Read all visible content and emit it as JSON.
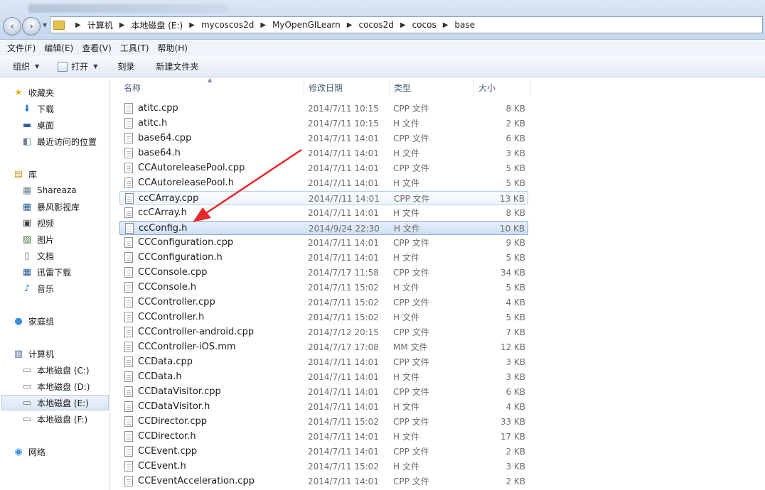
{
  "address": {
    "crumbs": [
      "计算机",
      "本地磁盘 (E:)",
      "mycoscos2d",
      "MyOpenGlLearn",
      "cocos2d",
      "cocos",
      "base"
    ]
  },
  "menu": [
    "文件(F)",
    "编辑(E)",
    "查看(V)",
    "工具(T)",
    "帮助(H)"
  ],
  "toolbar": {
    "organize": "组织",
    "open": "打开",
    "burn": "刻录",
    "new_folder": "新建文件夹"
  },
  "sidebar": {
    "favorites": {
      "label": "收藏夹",
      "items": [
        "下载",
        "桌面",
        "最近访问的位置"
      ]
    },
    "libraries": {
      "label": "库",
      "items": [
        "Shareaza",
        "暴风影视库",
        "视频",
        "图片",
        "文档",
        "迅雷下载",
        "音乐"
      ]
    },
    "homegroup": "家庭组",
    "computer": {
      "label": "计算机",
      "items": [
        "本地磁盘 (C:)",
        "本地磁盘 (D:)",
        "本地磁盘 (E:)",
        "本地磁盘 (F:)"
      ]
    },
    "network": "网络"
  },
  "columns": {
    "name": "名称",
    "date": "修改日期",
    "type": "类型",
    "size": "大小"
  },
  "files": [
    {
      "name": "atitc.cpp",
      "date": "2014/7/11 10:15",
      "type": "CPP 文件",
      "size": "8 KB"
    },
    {
      "name": "atitc.h",
      "date": "2014/7/11 10:15",
      "type": "H 文件",
      "size": "2 KB"
    },
    {
      "name": "base64.cpp",
      "date": "2014/7/11 14:01",
      "type": "CPP 文件",
      "size": "6 KB"
    },
    {
      "name": "base64.h",
      "date": "2014/7/11 14:01",
      "type": "H 文件",
      "size": "3 KB"
    },
    {
      "name": "CCAutoreleasePool.cpp",
      "date": "2014/7/11 14:01",
      "type": "CPP 文件",
      "size": "5 KB"
    },
    {
      "name": "CCAutoreleasePool.h",
      "date": "2014/7/11 14:01",
      "type": "H 文件",
      "size": "5 KB"
    },
    {
      "name": "ccCArray.cpp",
      "date": "2014/7/11 14:01",
      "type": "CPP 文件",
      "size": "13 KB"
    },
    {
      "name": "ccCArray.h",
      "date": "2014/7/11 14:01",
      "type": "H 文件",
      "size": "8 KB"
    },
    {
      "name": "ccConfig.h",
      "date": "2014/9/24 22:30",
      "type": "H 文件",
      "size": "10 KB"
    },
    {
      "name": "CCConfiguration.cpp",
      "date": "2014/7/11 14:01",
      "type": "CPP 文件",
      "size": "9 KB"
    },
    {
      "name": "CCConfiguration.h",
      "date": "2014/7/11 14:01",
      "type": "H 文件",
      "size": "5 KB"
    },
    {
      "name": "CCConsole.cpp",
      "date": "2014/7/17 11:58",
      "type": "CPP 文件",
      "size": "34 KB"
    },
    {
      "name": "CCConsole.h",
      "date": "2014/7/11 15:02",
      "type": "H 文件",
      "size": "5 KB"
    },
    {
      "name": "CCController.cpp",
      "date": "2014/7/11 15:02",
      "type": "CPP 文件",
      "size": "4 KB"
    },
    {
      "name": "CCController.h",
      "date": "2014/7/11 15:02",
      "type": "H 文件",
      "size": "5 KB"
    },
    {
      "name": "CCController-android.cpp",
      "date": "2014/7/12 20:15",
      "type": "CPP 文件",
      "size": "7 KB"
    },
    {
      "name": "CCController-iOS.mm",
      "date": "2014/7/17 17:08",
      "type": "MM 文件",
      "size": "12 KB"
    },
    {
      "name": "CCData.cpp",
      "date": "2014/7/11 14:01",
      "type": "CPP 文件",
      "size": "3 KB"
    },
    {
      "name": "CCData.h",
      "date": "2014/7/11 14:01",
      "type": "H 文件",
      "size": "3 KB"
    },
    {
      "name": "CCDataVisitor.cpp",
      "date": "2014/7/11 14:01",
      "type": "CPP 文件",
      "size": "6 KB"
    },
    {
      "name": "CCDataVisitor.h",
      "date": "2014/7/11 14:01",
      "type": "H 文件",
      "size": "4 KB"
    },
    {
      "name": "CCDirector.cpp",
      "date": "2014/7/11 15:02",
      "type": "CPP 文件",
      "size": "33 KB"
    },
    {
      "name": "CCDirector.h",
      "date": "2014/7/11 14:01",
      "type": "H 文件",
      "size": "17 KB"
    },
    {
      "name": "CCEvent.cpp",
      "date": "2014/7/11 14:01",
      "type": "CPP 文件",
      "size": "2 KB"
    },
    {
      "name": "CCEvent.h",
      "date": "2014/7/11 15:02",
      "type": "H 文件",
      "size": "3 KB"
    },
    {
      "name": "CCEventAcceleration.cpp",
      "date": "2014/7/11 14:01",
      "type": "CPP 文件",
      "size": "2 KB"
    }
  ],
  "hover_index": 6,
  "selected_index": 8,
  "colors": {
    "arrow": "#e8262a",
    "selection_border": "#84acdd"
  }
}
